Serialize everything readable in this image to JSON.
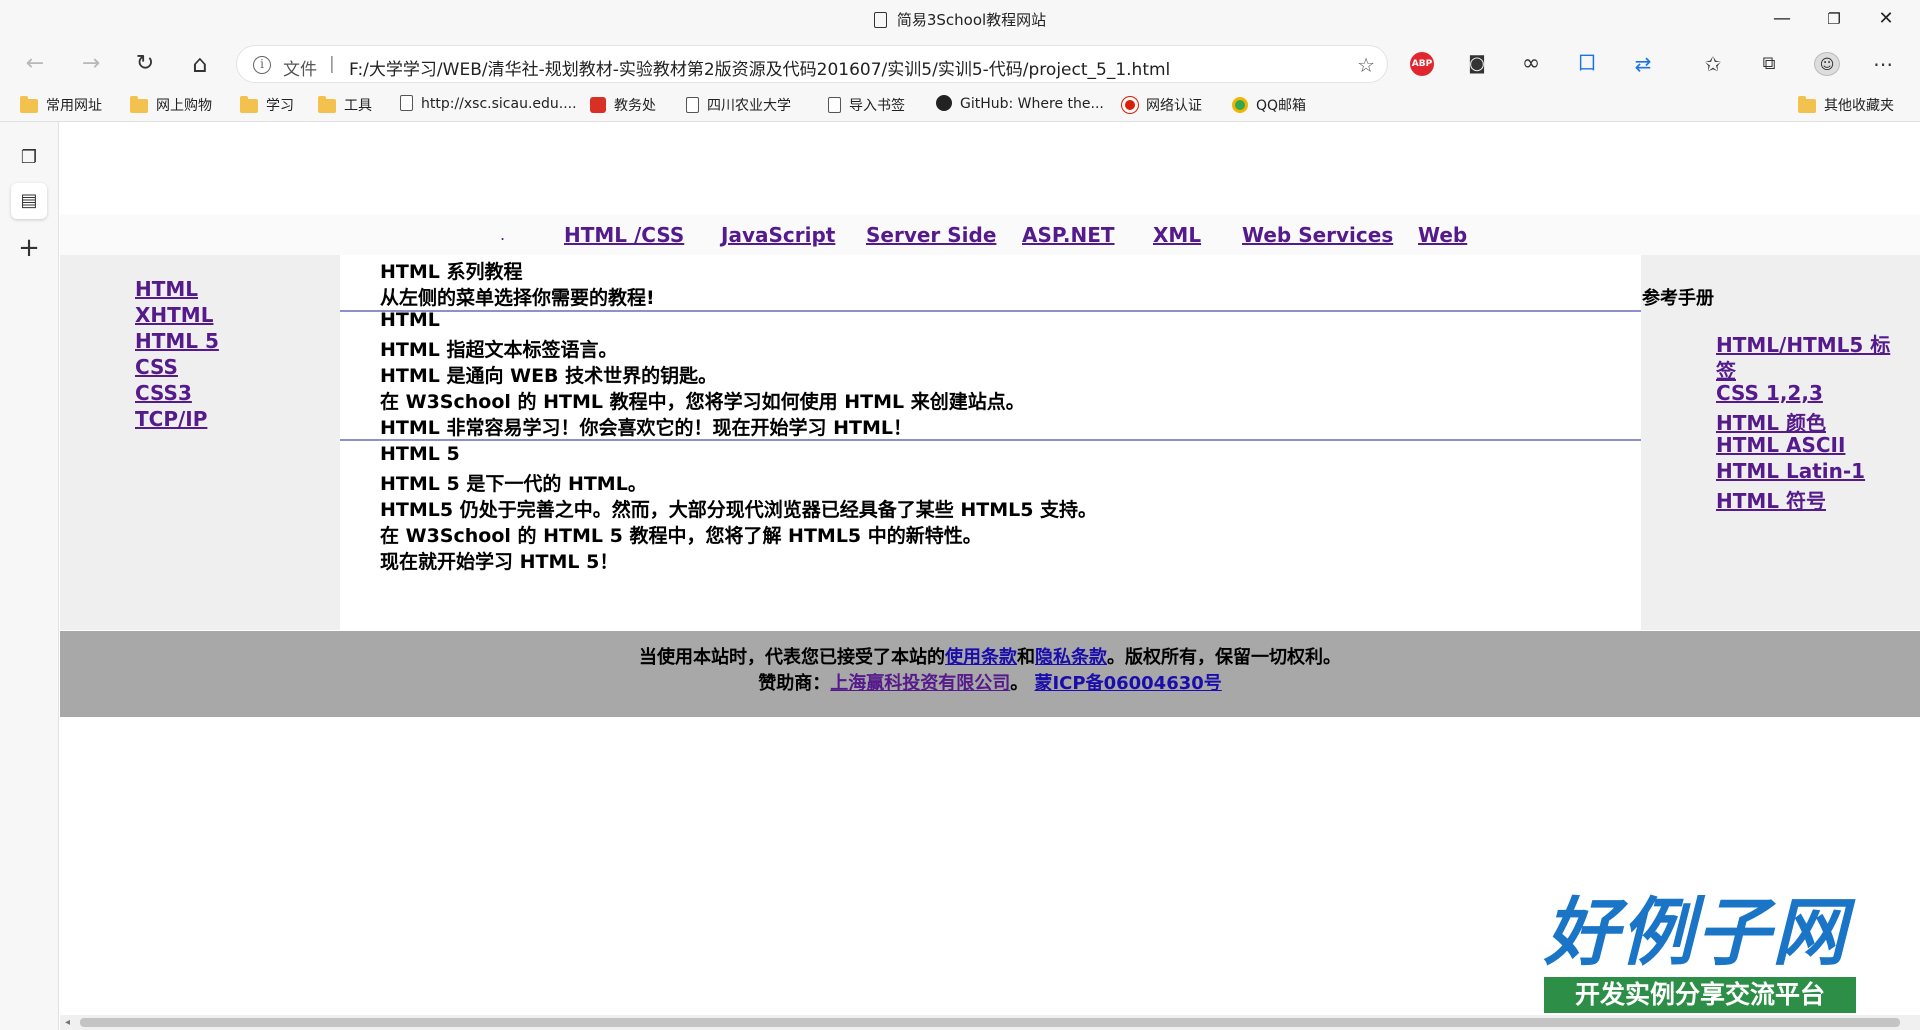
{
  "window": {
    "title": "简易3School教程网站",
    "controls": {
      "minimize": "—",
      "maximize": "❐",
      "close": "✕"
    }
  },
  "toolbar": {
    "back": "←",
    "forward": "→",
    "refresh": "↻",
    "home": "⌂",
    "address": {
      "info_icon": "i",
      "file_label": "文件",
      "separator": "|",
      "url": "F:/大学学习/WEB/清华社-规划教材-实验教材第2版资源及代码201607/实训5/实训5-代码/project_5_1.html",
      "favorite_icon": "☆"
    },
    "extensions": {
      "abp": "ABP",
      "tampermonkey": "◙",
      "infinity": "∞",
      "translate": "囗",
      "sync": "⇄",
      "favorites": "✩",
      "collections": "⧉",
      "avatar": "☺",
      "more": "⋯"
    }
  },
  "bookmarks": [
    {
      "label": "常用网址",
      "icon": "folder-icon"
    },
    {
      "label": "网上购物",
      "icon": "folder-icon"
    },
    {
      "label": "学习",
      "icon": "folder-icon"
    },
    {
      "label": "工具",
      "icon": "folder-icon"
    },
    {
      "label": "http://xsc.sicau.edu....",
      "icon": "page-icon"
    },
    {
      "label": "教务处",
      "icon": "red-home-icon"
    },
    {
      "label": "四川农业大学",
      "icon": "page-icon"
    },
    {
      "label": "导入书签",
      "icon": "page-icon"
    },
    {
      "label": "GitHub: Where the...",
      "icon": "github-icon"
    },
    {
      "label": "网络认证",
      "icon": "red-circle-icon"
    },
    {
      "label": "QQ邮箱",
      "icon": "qq-icon"
    },
    {
      "label": "其他收藏夹",
      "icon": "folder-icon"
    }
  ],
  "siderail": {
    "tabs_icon": "❐",
    "page_icon": "▤",
    "add_icon": "+"
  },
  "page": {
    "nav_dot": ".",
    "nav": [
      "HTML /CSS",
      "JavaScript",
      "Server Side",
      "ASP.NET ",
      "XML",
      "Web Services ",
      "Web"
    ],
    "left_links": [
      "HTML",
      "XHTML",
      "HTML 5",
      "CSS",
      "CSS3",
      "TCP/IP"
    ],
    "content": {
      "intro": [
        "HTML 系列教程",
        "从左侧的菜单选择你需要的教程!"
      ],
      "html": [
        "HTML",
        "HTML 指超文本标签语言。",
        "HTML 是通向 WEB 技术世界的钥匙。",
        "在 W3School 的 HTML 教程中，您将学习如何使用 HTML 来创建站点。",
        "HTML 非常容易学习！你会喜欢它的！现在开始学习 HTML！"
      ],
      "html5": [
        "HTML 5",
        "HTML 5 是下一代的 HTML。",
        "HTML5 仍处于完善之中。然而，大部分现代浏览器已经具备了某些 HTML5 支持。",
        "在 W3School 的 HTML 5 教程中，您将了解 HTML5 中的新特性。",
        "现在就开始学习 HTML 5！"
      ]
    },
    "reference": {
      "title": "参考手册",
      "links": [
        "HTML/HTML5 标",
        "签",
        "CSS 1,2,3",
        "HTML 颜色",
        "HTML ASCII",
        "HTML Latin-1",
        "HTML 符号"
      ]
    },
    "footer": {
      "line1_pre": "当使用本站时，代表您已接受了本站的",
      "terms": "使用条款",
      "and": "和",
      "privacy": "隐私条款",
      "line1_post": "。版权所有，保留一切权利。",
      "sponsor_label": "赞助商：",
      "sponsor": "上海赢科投资有限公司",
      "sep": "。 ",
      "icp": "蒙ICP备06004630号"
    }
  },
  "watermark": {
    "logo": "好例子网",
    "tagline": "开发实例分享交流平台"
  }
}
